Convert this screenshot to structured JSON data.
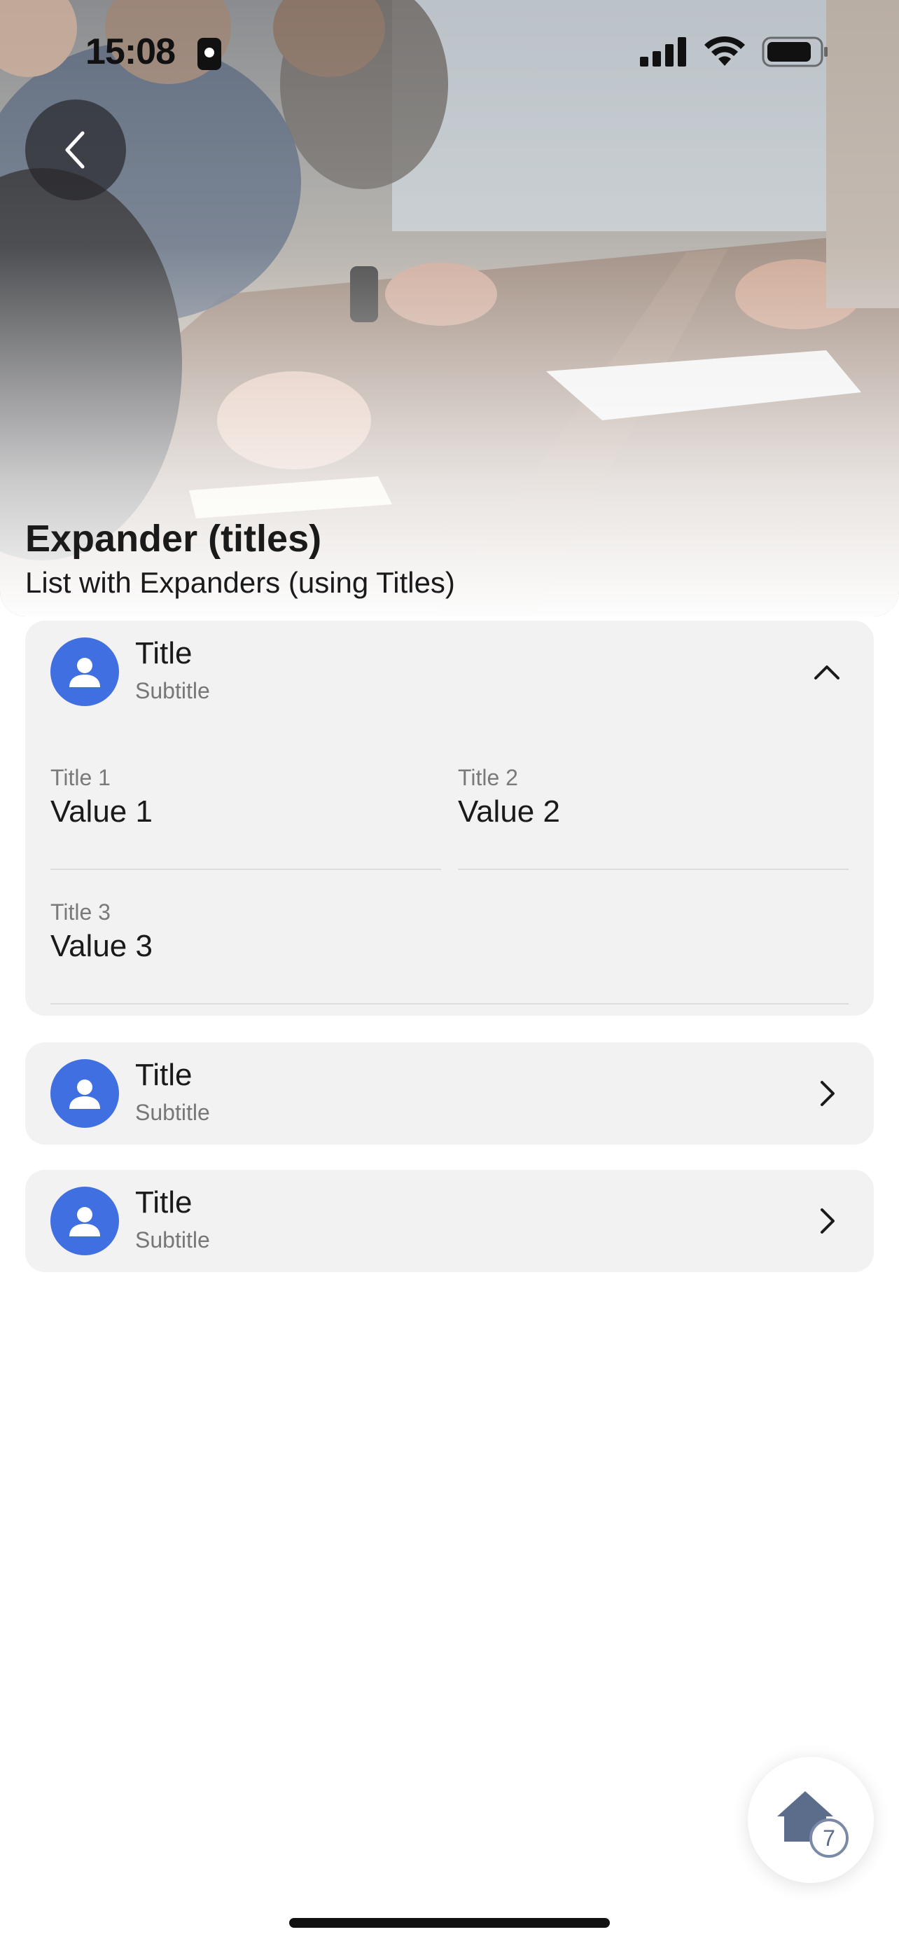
{
  "status_bar": {
    "time": "15:08"
  },
  "header": {
    "title": "Expander (titles)",
    "subtitle": "List with Expanders (using Titles)"
  },
  "icons": {
    "back": "chevron-left-icon",
    "expanded": "chevron-up-icon",
    "collapsed": "chevron-right-icon",
    "avatar": "person-icon",
    "home": "home-icon"
  },
  "colors": {
    "accent": "#3f6fe0",
    "card_background": "#f2f2f2",
    "subtitle_text": "#777777"
  },
  "list": {
    "items": [
      {
        "title": "Title",
        "subtitle": "Subtitle",
        "expanded": true,
        "fields": [
          {
            "label": "Title 1",
            "value": "Value 1"
          },
          {
            "label": "Title 2",
            "value": "Value 2"
          },
          {
            "label": "Title 3",
            "value": "Value 3"
          }
        ]
      },
      {
        "title": "Title",
        "subtitle": "Subtitle",
        "expanded": false
      },
      {
        "title": "Title",
        "subtitle": "Subtitle",
        "expanded": false
      }
    ]
  },
  "fab": {
    "badge_count": "7"
  }
}
